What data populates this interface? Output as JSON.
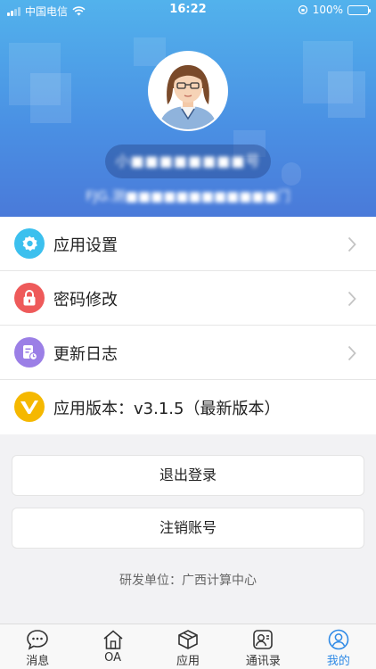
{
  "status_bar": {
    "carrier": "中国电信",
    "time": "16:22",
    "battery": "100%"
  },
  "profile": {
    "username": "小■■■■■■■■号",
    "department": "FJG.测■■■■■■■■■■■■门"
  },
  "menu": {
    "items": [
      {
        "label": "应用设置",
        "icon": "gear-icon",
        "color": "#3cc0ee"
      },
      {
        "label": "密码修改",
        "icon": "lock-icon",
        "color": "#ee5a5a"
      },
      {
        "label": "更新日志",
        "icon": "log-icon",
        "color": "#9b7fe6"
      },
      {
        "label": "应用版本：v3.1.5（最新版本）",
        "icon": "version-icon",
        "color": "#f5b800"
      }
    ]
  },
  "actions": {
    "logout": "退出登录",
    "deactivate": "注销账号"
  },
  "footer": {
    "developer": "研发单位：广西计算中心"
  },
  "tabbar": {
    "tabs": [
      {
        "label": "消息",
        "icon": "message-icon"
      },
      {
        "label": "OA",
        "icon": "home-icon"
      },
      {
        "label": "应用",
        "icon": "box-icon"
      },
      {
        "label": "通讯录",
        "icon": "contacts-icon"
      },
      {
        "label": "我的",
        "icon": "profile-icon",
        "active": true
      }
    ],
    "active_color": "#2f8ae6"
  }
}
